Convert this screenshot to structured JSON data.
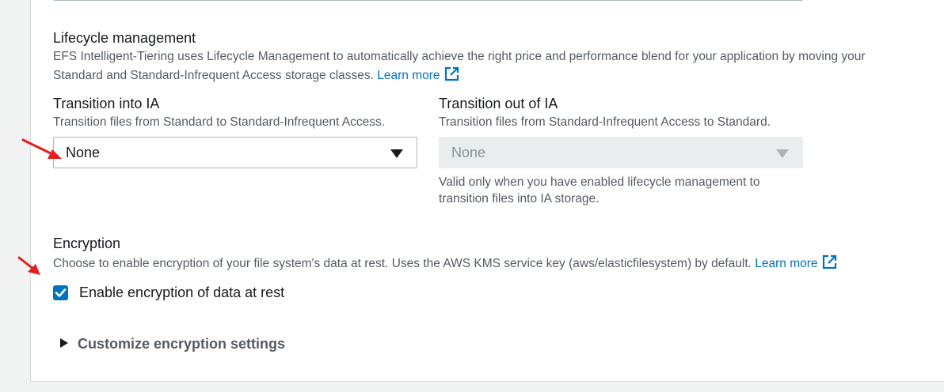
{
  "lifecycle": {
    "title": "Lifecycle management",
    "description_line1": "EFS Intelligent-Tiering uses Lifecycle Management to automatically achieve the right price and performance blend for your application by moving your",
    "description_line2": "Standard and Standard-Infrequent Access storage classes.",
    "learn_more": "Learn more"
  },
  "transition_into_ia": {
    "label": "Transition into IA",
    "description": "Transition files from Standard to Standard-Infrequent Access.",
    "selected": "None"
  },
  "transition_out_of_ia": {
    "label": "Transition out of IA",
    "description": "Transition files from Standard-Infrequent Access to Standard.",
    "selected": "None",
    "hint_line1": "Valid only when you have enabled lifecycle management to",
    "hint_line2": "transition files into IA storage."
  },
  "encryption": {
    "title": "Encryption",
    "description": "Choose to enable encryption of your file system's data at rest. Uses the AWS KMS service key (aws/elasticfilesystem) by default.",
    "learn_more": "Learn more",
    "checkbox_label": "Enable encryption of data at rest",
    "checkbox_checked": true,
    "customize_label": "Customize encryption settings"
  },
  "colors": {
    "accent": "#0073bb",
    "annotation_arrow": "#e41e1e"
  },
  "icons": {
    "external_link": "external-link-icon",
    "check": "check-icon",
    "caret_down": "caret-down-icon",
    "caret_right": "caret-right-icon"
  }
}
